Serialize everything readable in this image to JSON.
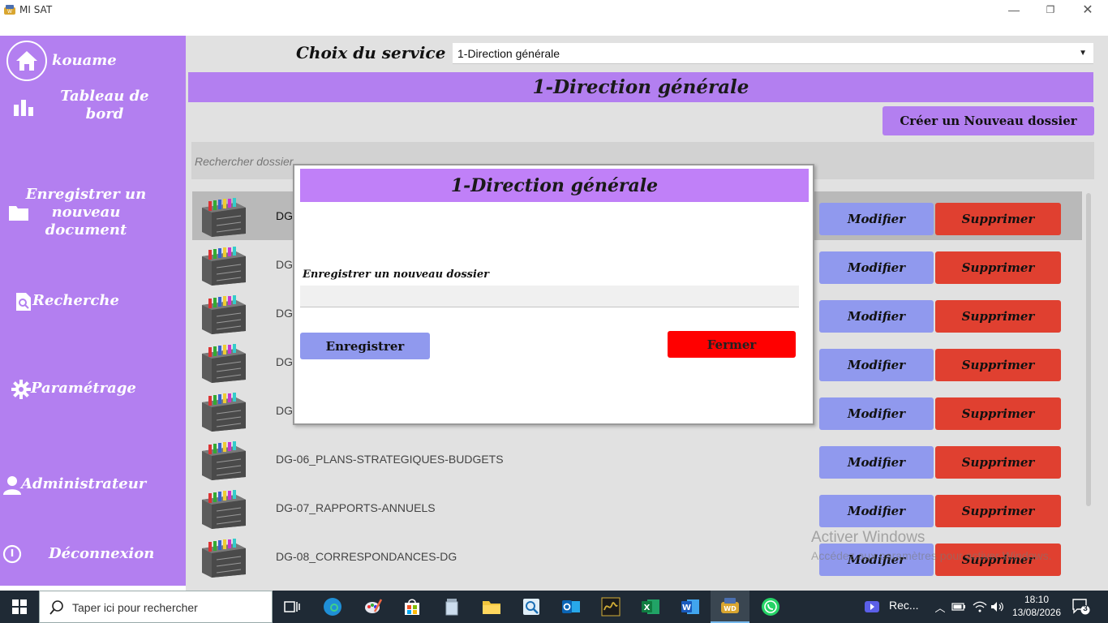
{
  "window": {
    "title": "MI SAT",
    "controls": {
      "minimize": "—",
      "restore": "❐",
      "close": "✕"
    }
  },
  "sidebar": {
    "user": "kouame",
    "items": [
      {
        "label": "Tableau de bord",
        "icon": "bar-chart-icon"
      },
      {
        "label": "Enregistrer un nouveau document",
        "icon": "folder-icon"
      },
      {
        "label": "Recherche",
        "icon": "search-doc-icon"
      },
      {
        "label": "Paramétrage",
        "icon": "gear-icon"
      },
      {
        "label": "Administrateur",
        "icon": "user-icon"
      },
      {
        "label": "Déconnexion",
        "icon": "power-icon"
      }
    ]
  },
  "header": {
    "service_label": "Choix du service",
    "service_selected": "1-Direction générale",
    "banner_title": "1-Direction générale",
    "new_folder_button": "Créer un Nouveau dossier",
    "search_placeholder": "Rechercher dossier"
  },
  "folders": {
    "modify_label": "Modifier",
    "delete_label": "Supprimer",
    "rows": [
      {
        "name": "DG"
      },
      {
        "name": "DG"
      },
      {
        "name": "DG"
      },
      {
        "name": "DG"
      },
      {
        "name": "DG"
      },
      {
        "name": "DG-06_PLANS-STRATEGIQUES-BUDGETS"
      },
      {
        "name": "DG-07_RAPPORTS-ANNUELS"
      },
      {
        "name": "DG-08_CORRESPONDANCES-DG"
      }
    ]
  },
  "modal": {
    "title": "1-Direction générale",
    "field_label": "Enregistrer un nouveau dossier",
    "field_value": "",
    "save_button": "Enregistrer",
    "close_button": "Fermer"
  },
  "watermark": {
    "title": "Activer Windows",
    "subtitle": "Accédez aux paramètres pour activer Windows."
  },
  "taskbar": {
    "search_text": "Taper ici pour rechercher",
    "recording_label": "Rec...",
    "time": "18:10",
    "date": "13/08/2026",
    "notifications": "3"
  },
  "colors": {
    "accent_purple": "#b37ff0",
    "modify_blue": "#9099ee",
    "delete_red": "#e04030",
    "close_red": "#ff0000"
  }
}
